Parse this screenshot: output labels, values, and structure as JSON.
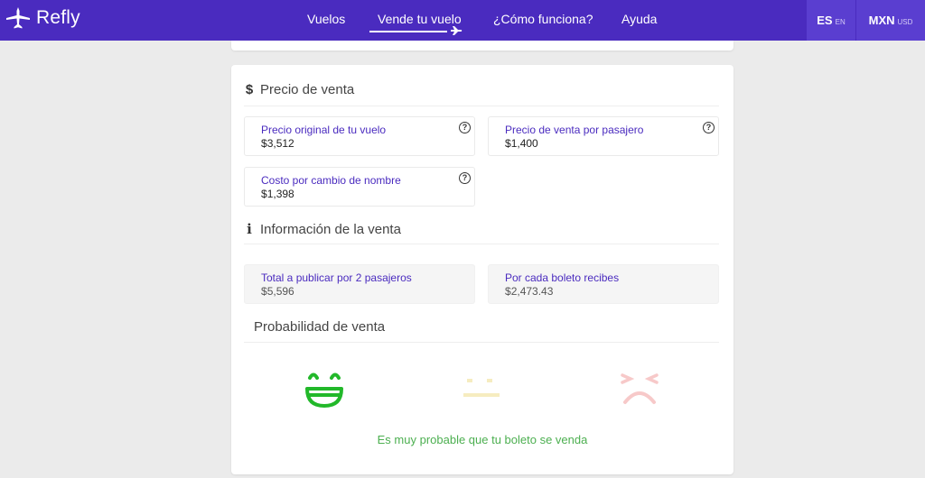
{
  "header": {
    "logo_text": "Refly",
    "nav": [
      {
        "label": "Vuelos"
      },
      {
        "label": "Vende tu vuelo",
        "active": true
      },
      {
        "label": "¿Cómo funciona?"
      },
      {
        "label": "Ayuda"
      }
    ],
    "language": {
      "selected": "ES",
      "alt": "EN"
    },
    "currency": {
      "selected": "MXN",
      "alt": "USD"
    },
    "brand_color": "#4a2bbf"
  },
  "price_section": {
    "title": "Precio de venta",
    "icon": "dollar-icon",
    "fields": [
      {
        "label": "Precio original de tu vuelo",
        "currency": "$",
        "value": "3,512",
        "help": "?"
      },
      {
        "label": "Precio de venta por pasajero",
        "currency": "$",
        "value": "1,400",
        "help": "?"
      },
      {
        "label": "Costo por cambio de nombre",
        "currency": "$",
        "value": "1,398",
        "help": "?"
      }
    ]
  },
  "info_section": {
    "title": "Información de la venta",
    "icon": "info-icon",
    "fields": [
      {
        "label": "Total a publicar por 2 pasajeros",
        "currency": "$",
        "value": "5,596"
      },
      {
        "label": "Por cada boleto recibes",
        "currency": "$",
        "value": "2,473.43"
      }
    ]
  },
  "probability_section": {
    "title": "Probabilidad de venta",
    "faces": [
      {
        "name": "happy-face-icon",
        "color": "#22b82a",
        "active": true
      },
      {
        "name": "neutral-face-icon",
        "color": "#f6ecc0",
        "active": false
      },
      {
        "name": "sad-face-icon",
        "color": "#f7c9c9",
        "active": false
      }
    ],
    "message": "Es muy probable que tu boleto se venda",
    "message_color": "#4caf50"
  }
}
